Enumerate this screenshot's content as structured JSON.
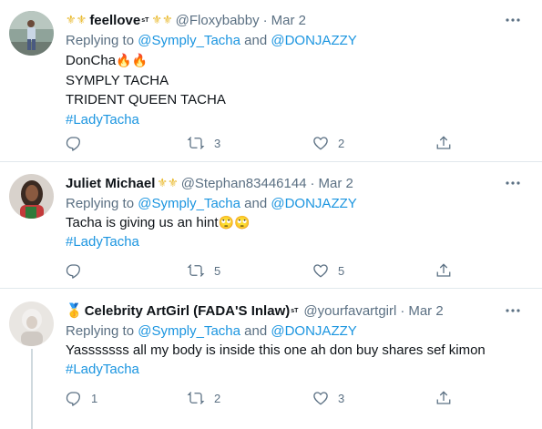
{
  "tweets": [
    {
      "display_name": "feellove",
      "name_prefix_icons": "⚜⚜",
      "name_suffix_super": "sT",
      "name_suffix_icons": "⚜⚜",
      "handle": "@Floxybabby",
      "separator": "·",
      "date": "Mar 2",
      "replying_prefix": "Replying to",
      "reply_mention_1": "@Symply_Tacha",
      "reply_and": "and",
      "reply_mention_2": "@DONJAZZY",
      "lines": [
        "DonCha",
        "SYMPLY TACHA",
        "TRIDENT QUEEN TACHA"
      ],
      "line1_emoji": "🔥🔥",
      "hashtag": "#LadyTacha",
      "reply_count": "",
      "retweet_count": "3",
      "like_count": "2"
    },
    {
      "display_name": "Juliet Michael",
      "name_suffix_icons": "⚜⚜",
      "handle": "@Stephan83446144",
      "separator": "·",
      "date": "Mar 2",
      "replying_prefix": "Replying to",
      "reply_mention_1": "@Symply_Tacha",
      "reply_and": "and",
      "reply_mention_2": "@DONJAZZY",
      "text": "Tacha is giving us an hint",
      "text_emoji": "🙄🙄",
      "hashtag": "#LadyTacha",
      "reply_count": "",
      "retweet_count": "5",
      "like_count": "5"
    },
    {
      "name_prefix_icon": "🥇",
      "display_name": "Celebrity ArtGirl (FADA'S Inlaw)",
      "name_suffix_super": "sT",
      "handle": "@yourfavartgirl",
      "separator": "·",
      "date": "Mar 2",
      "replying_prefix": "Replying to",
      "reply_mention_1": "@Symply_Tacha",
      "reply_and": "and",
      "reply_mention_2": "@DONJAZZY",
      "text": "Yasssssss all my body is inside this one ah don buy shares sef kimon",
      "hashtag": "#LadyTacha",
      "reply_count": "1",
      "retweet_count": "2",
      "like_count": "3"
    }
  ],
  "icons": {
    "reply": "reply-icon",
    "retweet": "retweet-icon",
    "like": "heart-icon",
    "share": "share-icon",
    "more": "more-icon"
  },
  "colors": {
    "link": "#1b95e0",
    "secondary_text": "#5b7083",
    "divider": "#e1e8ed",
    "crown": "#e8b623"
  }
}
